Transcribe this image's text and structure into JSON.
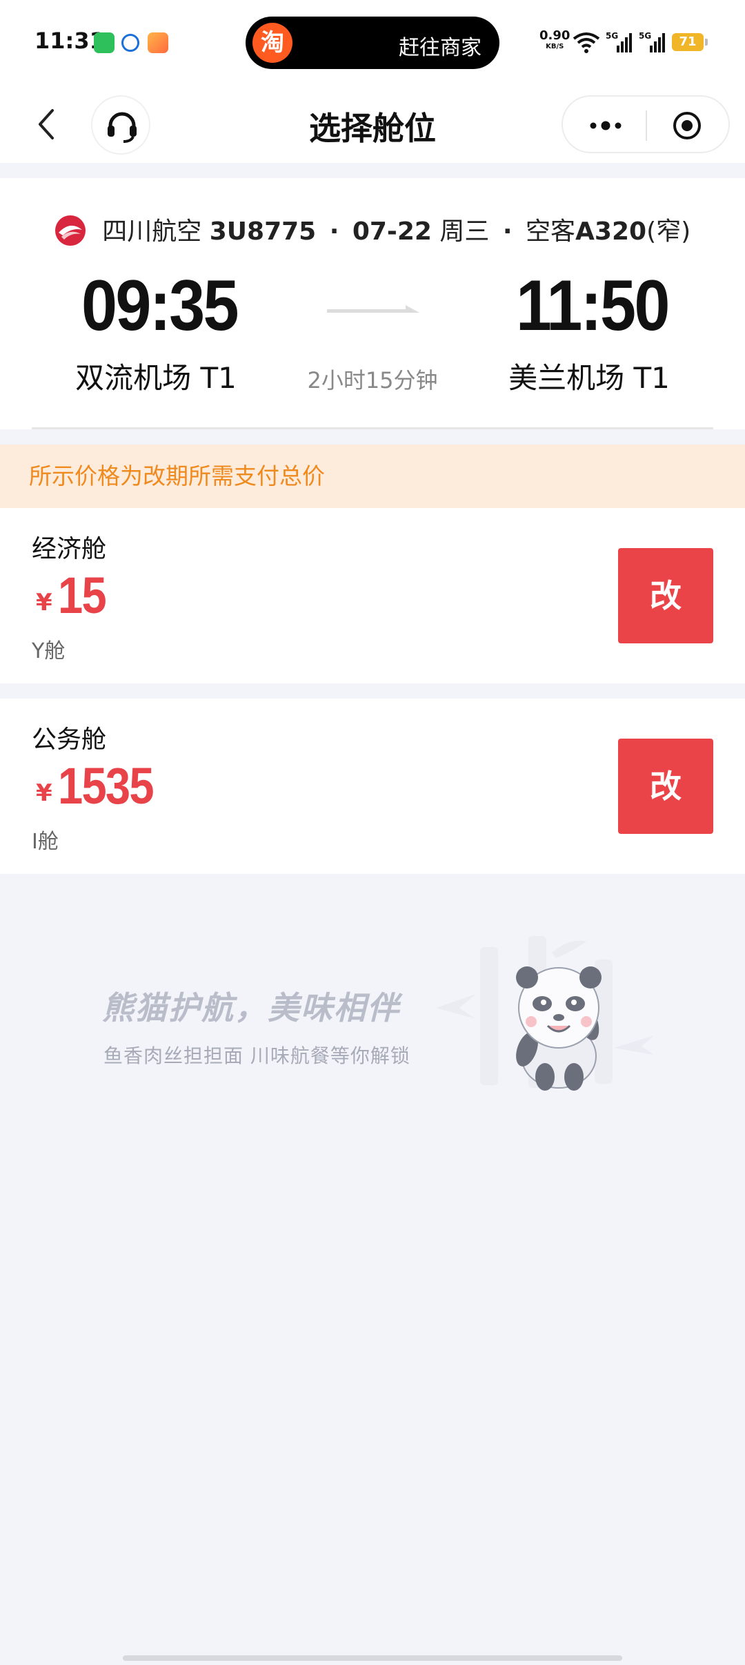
{
  "status_bar": {
    "time": "11:31",
    "island_logo": "淘",
    "island_text": "赶往商家",
    "net_speed": "0.90",
    "net_unit": "KB/S",
    "sig1_label": "5G",
    "sig2_label": "5G",
    "battery": "71"
  },
  "nav": {
    "title": "选择舱位"
  },
  "flight": {
    "airline": "四川航空",
    "flight_no": "3U8775",
    "date": "07-22",
    "weekday": "周三",
    "aircraft": "空客",
    "aircraft_model": "A320",
    "aircraft_size": "(窄)",
    "dep_time": "09:35",
    "arr_time": "11:50",
    "dep_airport": "双流机场 T1",
    "arr_airport": "美兰机场 T1",
    "duration": "2小时15分钟"
  },
  "notice": "所示价格为改期所需支付总价",
  "cabins": [
    {
      "name": "经济舱",
      "currency": "¥",
      "price": "15",
      "class_code": "Y舱",
      "button": "改"
    },
    {
      "name": "公务舱",
      "currency": "¥",
      "price": "1535",
      "class_code": "I舱",
      "button": "改"
    }
  ],
  "promo": {
    "title": "熊猫护航，美味相伴",
    "subtitle": "鱼香肉丝担担面  川味航餐等你解锁"
  },
  "colors": {
    "accent_red": "#eb4448",
    "price_red": "#e9434a",
    "notice_bg": "#fdebdb",
    "notice_text": "#ef8a1f",
    "page_bg": "#f3f4f9"
  }
}
